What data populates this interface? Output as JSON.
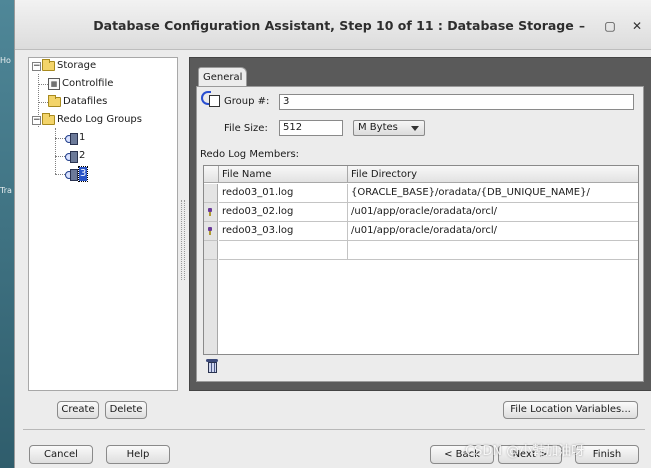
{
  "window": {
    "title": "Database Configuration Assistant, Step 10 of 11 : Database Storage",
    "controls": [
      "–",
      "▢",
      "✕"
    ]
  },
  "desktop_labels": [
    "Ho",
    "Tra"
  ],
  "tree": {
    "root": "Storage",
    "items": [
      {
        "label": "Controlfile",
        "icon": "controlfile-icon"
      },
      {
        "label": "Datafiles",
        "icon": "folder-icon"
      },
      {
        "label": "Redo Log Groups",
        "icon": "folder-icon"
      }
    ],
    "groups": [
      "1",
      "2",
      "3"
    ],
    "selected_group": "3"
  },
  "tab": {
    "label": "General"
  },
  "form": {
    "group_label": "Group #:",
    "group_value": "3",
    "filesize_label": "File Size:",
    "filesize_value": "512",
    "unit_value": "M Bytes",
    "members_label": "Redo Log Members:"
  },
  "table": {
    "columns": [
      "File Name",
      "File Directory"
    ],
    "rows": [
      {
        "name": "redo03_01.log",
        "dir": "{ORACLE_BASE}/oradata/{DB_UNIQUE_NAME}/",
        "pinned": false
      },
      {
        "name": "redo03_02.log",
        "dir": "/u01/app/oracle/oradata/orcl/",
        "pinned": true
      },
      {
        "name": "redo03_03.log",
        "dir": "/u01/app/oracle/oradata/orcl/",
        "pinned": true
      }
    ]
  },
  "buttons": {
    "create": "Create",
    "delete": "Delete",
    "file_location": "File Location Variables...",
    "cancel": "Cancel",
    "help": "Help",
    "back": "Back",
    "next": "Next",
    "finish": "Finish"
  },
  "watermark": "CSDN @小韩加油呀"
}
